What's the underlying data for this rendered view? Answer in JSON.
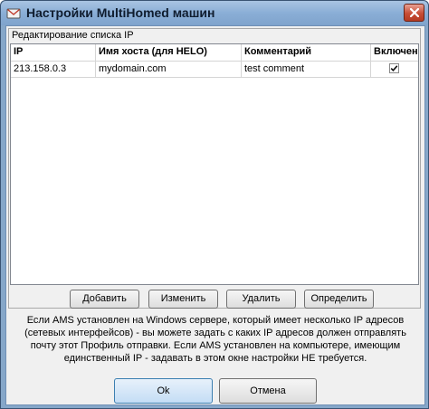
{
  "window": {
    "title": "Настройки MultiHomed машин"
  },
  "group": {
    "title": "Редактирование списка IP"
  },
  "table": {
    "columns": [
      "IP",
      "Имя хоста (для HELO)",
      "Комментарий",
      "Включен"
    ],
    "rows": [
      {
        "ip": "213.158.0.3",
        "hostname": "mydomain.com",
        "comment": "test comment",
        "enabled": true
      }
    ]
  },
  "buttons": {
    "add": "Добавить",
    "edit": "Изменить",
    "delete": "Удалить",
    "detect": "Определить"
  },
  "info_lines": [
    "Если AMS установлен на Windows сервере, который имеет несколько IP адресов",
    "(сетевых интерфейсов) - вы можете задать с каких IP адресов должен отправлять",
    "почту этот Профиль отправки. Если AMS установлен на компьютере, имеющим",
    "единственный IP - задавать в этом окне настройки НЕ требуется."
  ],
  "footer": {
    "ok": "Ok",
    "cancel": "Отмена"
  },
  "icons": {
    "app": "app-icon",
    "close": "close-icon",
    "check": "checkmark-icon"
  }
}
